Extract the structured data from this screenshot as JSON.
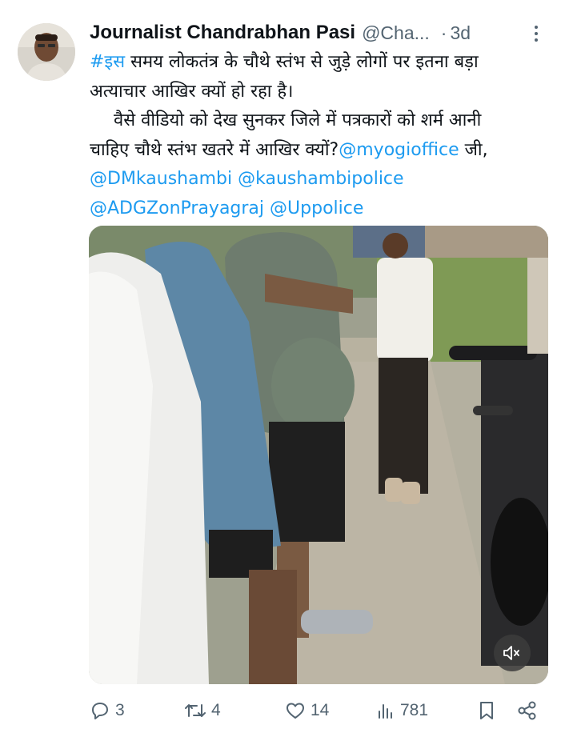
{
  "author": {
    "display_name": "Journalist Chandrabhan Pasi",
    "handle": "@Cha...",
    "separator": "·",
    "time": "3d"
  },
  "tweet": {
    "line1_hashtag": "#इस",
    "line1_rest": " समय लोकतंत्र के चौथे स्तंभ से जुड़े लोगों पर इतना बड़ा",
    "line2": "अत्याचार आखिर क्यों हो रहा है।",
    "line3": "वैसे वीडियो को देख सुनकर जिले में पत्रकारों को शर्म आनी",
    "line4_text": "चाहिए चौथे स्तंभ खतरे में आखिर क्यों?",
    "line4_mention": "@myogioffice",
    "line4_suffix": " जी,",
    "mention_dm": "@DMkaushambi",
    "mention_police": "@kaushambipolice",
    "mention_adg": "@ADGZonPrayagraj",
    "mention_up": "@Uppolice"
  },
  "media": {
    "mute_icon": "speaker-muted-icon"
  },
  "actions": {
    "replies": "3",
    "reposts": "4",
    "likes": "14",
    "views": "781"
  },
  "colors": {
    "link": "#1d9bf0",
    "muted_text": "#536471",
    "text": "#0f1419"
  }
}
